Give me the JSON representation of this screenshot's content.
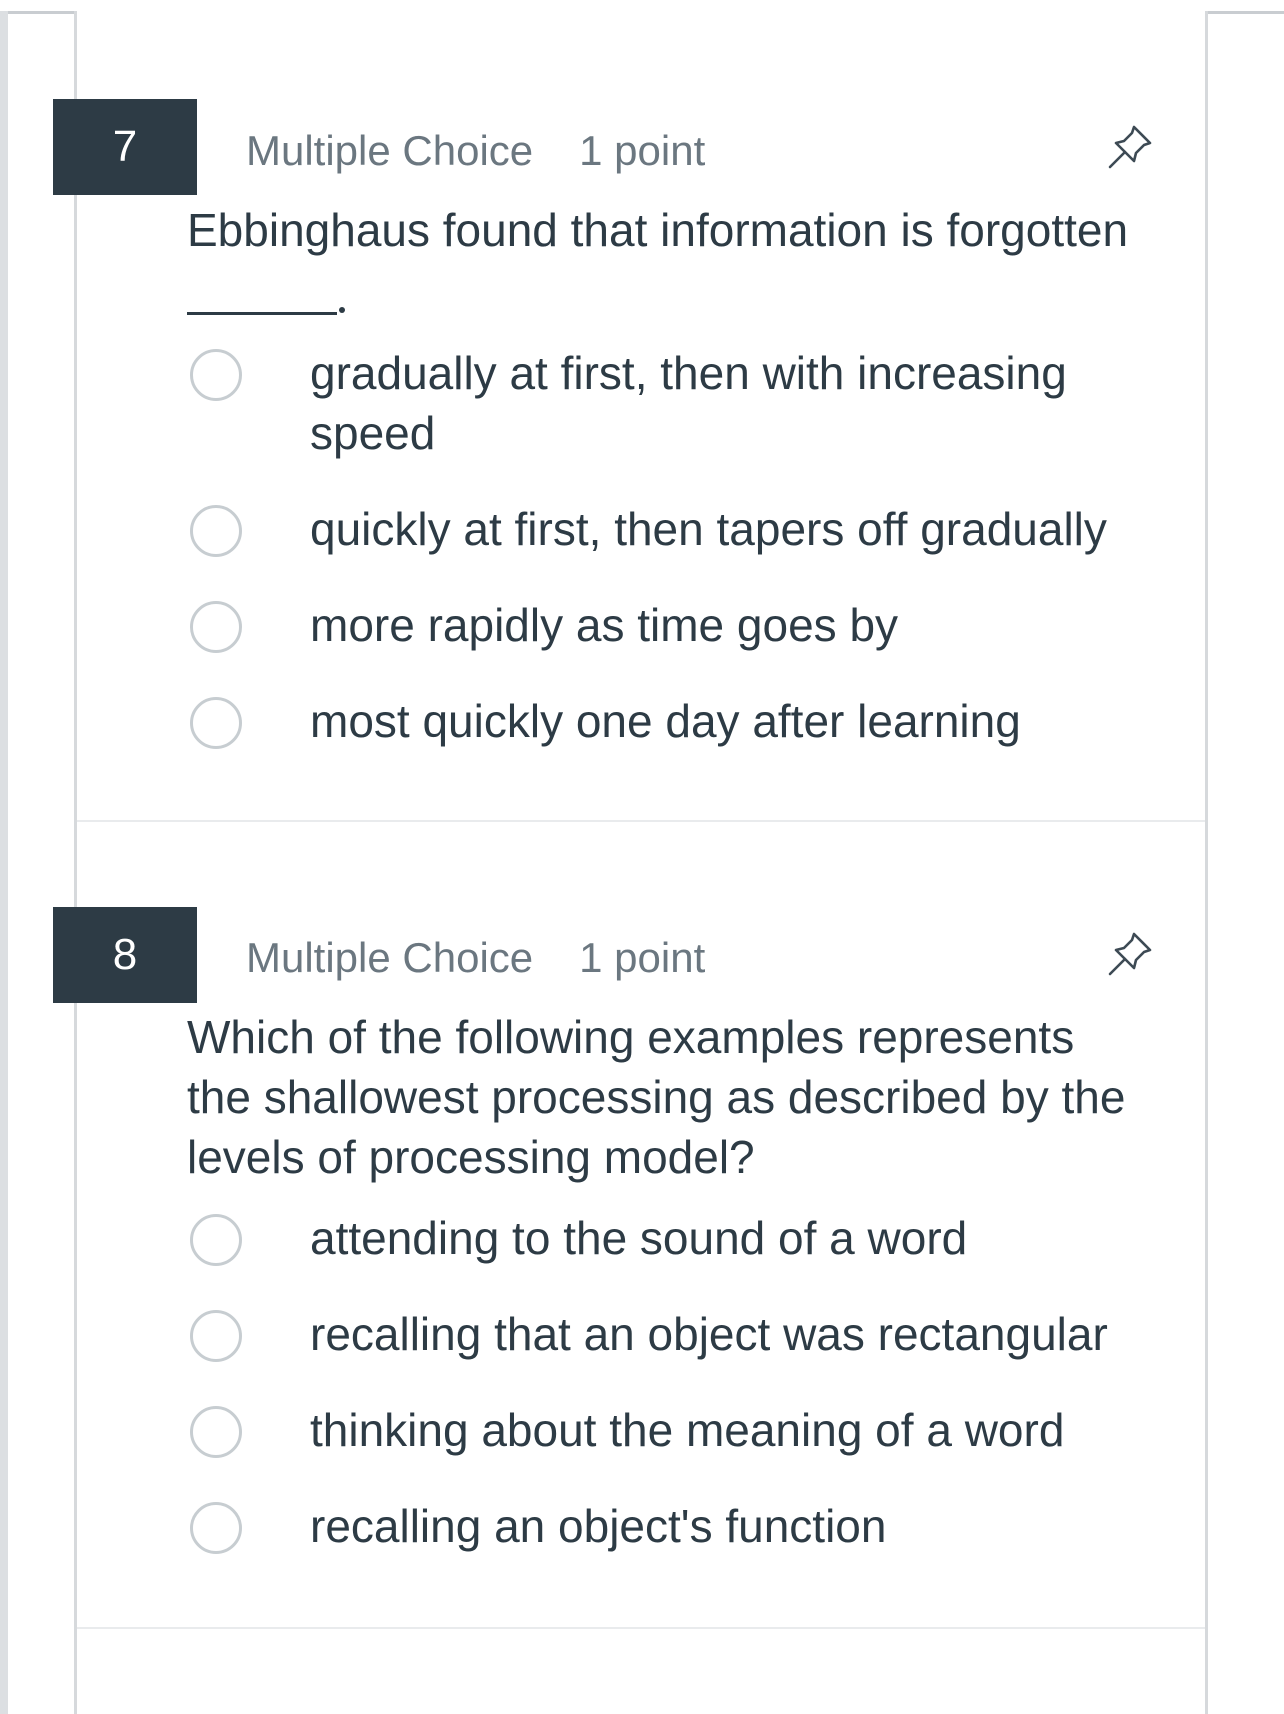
{
  "questions": [
    {
      "number": "7",
      "type_label": "Multiple Choice",
      "points_label": "1 point",
      "pin_icon": "pushpin-icon",
      "text": "Ebbinghaus found that information is forgotten",
      "blank": "______.",
      "options": [
        {
          "label": "gradually at first, then with increasing speed",
          "selected": false
        },
        {
          "label": "quickly at first, then tapers off gradually",
          "selected": false
        },
        {
          "label": "more rapidly as time goes by",
          "selected": false
        },
        {
          "label": "most quickly one day after learning",
          "selected": false
        }
      ]
    },
    {
      "number": "8",
      "type_label": "Multiple Choice",
      "points_label": "1 point",
      "pin_icon": "pushpin-icon",
      "text": "Which of the following examples represents the shallowest processing as described by the levels of processing model?",
      "options": [
        {
          "label": "attending to the sound of a word",
          "selected": false
        },
        {
          "label": "recalling that an object was rectangular",
          "selected": false
        },
        {
          "label": "thinking about the meaning of a word",
          "selected": false
        },
        {
          "label": "recalling an object's function",
          "selected": false
        }
      ]
    }
  ],
  "colors": {
    "badge_bg": "#2d3b45",
    "text": "#2d3b45",
    "meta_text": "#6b7780",
    "radio_border": "#c7cdd1"
  }
}
